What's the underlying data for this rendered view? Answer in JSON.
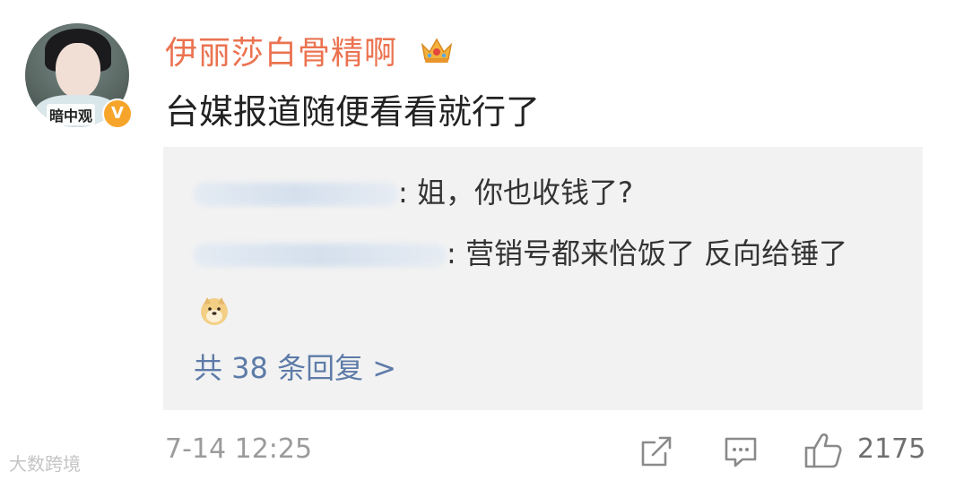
{
  "post": {
    "avatar_caption": "暗中观",
    "verified_mark": "V",
    "username": "伊丽莎白骨精啊",
    "comment": "台媒报道随便看看就行了",
    "timestamp": "7-14 12:25",
    "like_count": "2175"
  },
  "replies": {
    "reply1_text": ": 姐，你也收钱了?",
    "reply2_text": ": 营销号都来恰饭了 反向给锤了",
    "more_label": "共 38 条回复 >"
  },
  "watermark": "大数跨境",
  "icons": {
    "crown": "crown-icon",
    "doge": "doge-emoji-icon",
    "share": "share-icon",
    "comment": "comment-icon",
    "like": "thumbs-up-icon"
  },
  "colors": {
    "username": "#eb7350",
    "link": "#5d7ba8",
    "reply_bg": "#f2f2f2",
    "muted": "#9b9b9b"
  }
}
